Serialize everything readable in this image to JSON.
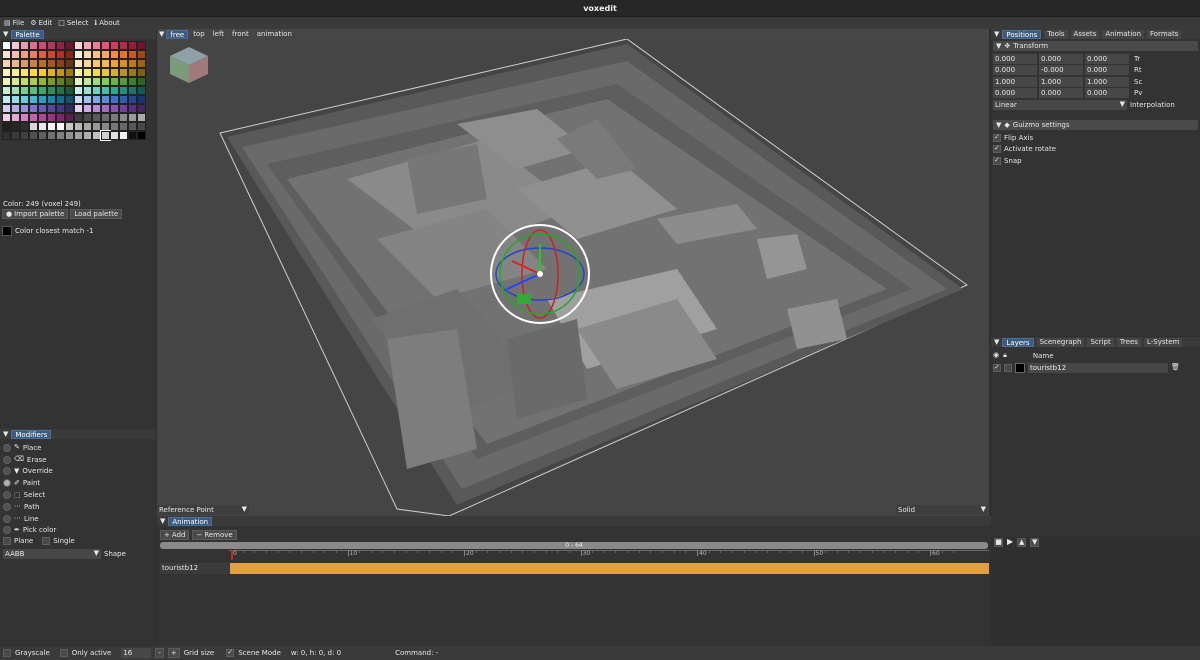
{
  "window": {
    "title": "voxedit"
  },
  "menu": [
    {
      "icon": "file-icon",
      "label": "File"
    },
    {
      "icon": "gear-icon",
      "label": "Edit"
    },
    {
      "icon": "select-icon",
      "label": "Select"
    },
    {
      "icon": "info-icon",
      "label": "About"
    }
  ],
  "palette": {
    "tab": "Palette",
    "color_info": "Color: 249 (voxel 249)",
    "import_label": "Import palette",
    "load_label": "Load palette",
    "closest_label": "Color closest match  -1",
    "colors": [
      "#ffffff",
      "#f4c6d0",
      "#e89ab0",
      "#d9708e",
      "#c94f6e",
      "#b03858",
      "#8f2444",
      "#6d1532",
      "#ffd6dc",
      "#f7a6b6",
      "#ef7a94",
      "#e35576",
      "#d33c5e",
      "#b82a4a",
      "#961c3a",
      "#731230",
      "#fbe0d6",
      "#f7bfae",
      "#f39c86",
      "#ec7c62",
      "#e25d46",
      "#cf4532",
      "#b03223",
      "#8c2318",
      "#fff0e0",
      "#ffd8b4",
      "#ffbf88",
      "#ffa560",
      "#f98c3e",
      "#e87426",
      "#c95d18",
      "#a3490f",
      "#f6d3b8",
      "#ecb58e",
      "#e09868",
      "#d27e4a",
      "#c06732",
      "#a85324",
      "#8b421a",
      "#6d3312",
      "#ffe9c4",
      "#ffd79a",
      "#ffc670",
      "#ffb54b",
      "#f7a12e",
      "#e38c1c",
      "#c57613",
      "#a3610d",
      "#fff6c2",
      "#ffee94",
      "#ffe468",
      "#ffd944",
      "#f7c92a",
      "#e0b31b",
      "#c09614",
      "#9c780e",
      "#fdf3b0",
      "#f8e77a",
      "#f2d94e",
      "#e6c834",
      "#d4b125",
      "#b8951a",
      "#987a12",
      "#7a620d",
      "#eef3b8",
      "#dbe88c",
      "#c6da66",
      "#afca48",
      "#96b632",
      "#7e9c25",
      "#65801b",
      "#4e6414",
      "#e0f4c4",
      "#c2e89e",
      "#a2da7a",
      "#83ca5c",
      "#66b646",
      "#4f9c38",
      "#3c802c",
      "#2c6420",
      "#c8efd0",
      "#a2e0b0",
      "#7ccf92",
      "#5abd78",
      "#3fa864",
      "#2e8e54",
      "#227446",
      "#185a38",
      "#c6f0e6",
      "#9ae2d2",
      "#6ed2bd",
      "#48bfa8",
      "#2ea994",
      "#208f80",
      "#18746b",
      "#105a56",
      "#c4ecf4",
      "#98dcea",
      "#6ccadf",
      "#46b6d2",
      "#2c9ec2",
      "#1f84ab",
      "#166a8f",
      "#0f5272",
      "#c8ddf7",
      "#a2c4f0",
      "#7ca8e6",
      "#5a8cd9",
      "#3f72c8",
      "#2e5cb0",
      "#224894",
      "#183676",
      "#d4d0f4",
      "#b4ace8",
      "#9690da",
      "#7c74ca",
      "#655cb6",
      "#52489e",
      "#423884",
      "#322a68",
      "#e6d0f2",
      "#d0ace6",
      "#b98ad8",
      "#a26cc6",
      "#8a52b2",
      "#73409a",
      "#5c3080",
      "#462464",
      "#f4cce8",
      "#e8a6d6",
      "#da80c2",
      "#c960ac",
      "#b44696",
      "#9a3480",
      "#7e266a",
      "#621c52",
      "#3c3c3c",
      "#4a4a4a",
      "#5a5a5a",
      "#6a6a6a",
      "#7a7a7a",
      "#8a8a8a",
      "#9a9a9a",
      "#aaaaaa",
      "#1e1e1e",
      "#262626",
      "#2e2e2e",
      "#d8d8d8",
      "#e8e8e8",
      "#f4f4f4",
      "#ffffff",
      "#c8c8c8",
      "#b8b8b8",
      "#a8a8a8",
      "#989898",
      "#888888",
      "#787878",
      "#686868",
      "#585858",
      "#484848",
      "#303030",
      "#3a3a3a",
      "#404040",
      "#505050",
      "#606060",
      "#707070",
      "#808080",
      "#909090",
      "#a0a0a0",
      "#b0b0b0",
      "#c0c0c0",
      "#d0d0d0",
      "#e0e0e0",
      "#f0f0f0",
      "#101010",
      "#000000"
    ]
  },
  "modifiers": {
    "tab": "Modifiers",
    "items": [
      {
        "icon": "place-icon",
        "label": "Place"
      },
      {
        "icon": "erase-icon",
        "label": "Erase"
      },
      {
        "icon": "override-icon",
        "label": "Override"
      },
      {
        "icon": "paint-icon",
        "label": "Paint"
      },
      {
        "icon": "select-icon",
        "label": "Select"
      },
      {
        "icon": "path-icon",
        "label": "Path"
      },
      {
        "icon": "line-icon",
        "label": "Line"
      },
      {
        "icon": "pick-color-icon",
        "label": "Pick color"
      }
    ],
    "active": "Paint",
    "plane": "Plane",
    "single": "Single",
    "shape_value": "AABB",
    "shape_label": "Shape"
  },
  "viewport": {
    "tabs": [
      "free",
      "top",
      "left",
      "front",
      "animation"
    ],
    "active_tab": "free",
    "ref_point": "Reference Point",
    "render_mode": "Solid"
  },
  "animation": {
    "tab": "Animation",
    "add": "Add",
    "remove": "Remove",
    "range": "0 - 64",
    "ticks": [
      "0",
      "10",
      "20",
      "30",
      "40",
      "50",
      "60"
    ],
    "track_name": "touristb12"
  },
  "positions": {
    "tabs": [
      "Positions",
      "Tools",
      "Assets",
      "Animation",
      "Formats"
    ],
    "transform_label": "Transform",
    "rows": [
      {
        "vals": [
          "0.000",
          "0.000",
          "0.000"
        ],
        "label": "Tr"
      },
      {
        "vals": [
          "0.000",
          "-0.000",
          "0.000"
        ],
        "label": "Rt"
      },
      {
        "vals": [
          "1.000",
          "1.000",
          "1.000"
        ],
        "label": "Sc"
      },
      {
        "vals": [
          "0.000",
          "0.000",
          "0.000"
        ],
        "label": "Pv"
      }
    ],
    "interp_value": "Linear",
    "interp_label": "Interpolation",
    "guizmo_label": "Guizmo settings",
    "options": [
      {
        "label": "Flip Axis",
        "on": true
      },
      {
        "label": "Activate rotate",
        "on": true
      },
      {
        "label": "Snap",
        "on": true
      }
    ]
  },
  "layers": {
    "tabs": [
      "Layers",
      "Scenegraph",
      "Script",
      "Trees",
      "L-System"
    ],
    "name_col": "Name",
    "layer_name": "touristb12"
  },
  "statusbar": {
    "grayscale": "Grayscale",
    "only_active": "Only active",
    "grid_value": "16",
    "grid_label": "Grid size",
    "scene_mode": "Scene Mode",
    "dims": "w: 0, h: 0, d: 0",
    "command": "Command: -"
  }
}
